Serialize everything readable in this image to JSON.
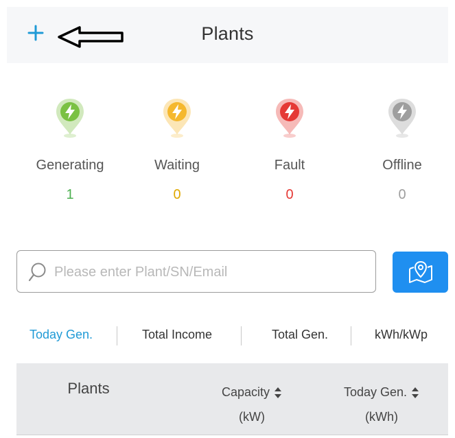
{
  "header": {
    "title": "Plants",
    "add_icon": "plus-icon",
    "annotation_icon": "arrow-left-icon"
  },
  "status": [
    {
      "label": "Generating",
      "count": "1",
      "color": "#7ac143",
      "count_color": "#4caf50",
      "icon": "lightning-pin-icon"
    },
    {
      "label": "Waiting",
      "count": "0",
      "color": "#f5b82e",
      "count_color": "#e0a800",
      "icon": "lightning-pin-icon"
    },
    {
      "label": "Fault",
      "count": "0",
      "color": "#e53935",
      "count_color": "#e53935",
      "icon": "lightning-pin-icon"
    },
    {
      "label": "Offline",
      "count": "0",
      "color": "#9e9e9e",
      "count_color": "#9e9e9e",
      "icon": "lightning-pin-icon"
    }
  ],
  "search": {
    "placeholder": "Please enter Plant/SN/Email",
    "value": "",
    "icon": "search-icon"
  },
  "map_button": {
    "icon": "map-pin-icon",
    "color": "#1f8ff0"
  },
  "sort_tabs": [
    {
      "label": "Today Gen.",
      "active": true
    },
    {
      "label": "Total Income",
      "active": false
    },
    {
      "label": "Total Gen.",
      "active": false
    },
    {
      "label": "kWh/kWp",
      "active": false
    }
  ],
  "table": {
    "columns": [
      {
        "label": "Plants",
        "unit": ""
      },
      {
        "label": "Capacity",
        "unit": "(kW)",
        "sortable": true
      },
      {
        "label": "Today Gen.",
        "unit": "(kWh)",
        "sortable": true
      }
    ]
  },
  "colors": {
    "accent": "#1f9ad6",
    "header_bg": "#f6f7f9",
    "table_header_bg": "#e8e9eb"
  }
}
